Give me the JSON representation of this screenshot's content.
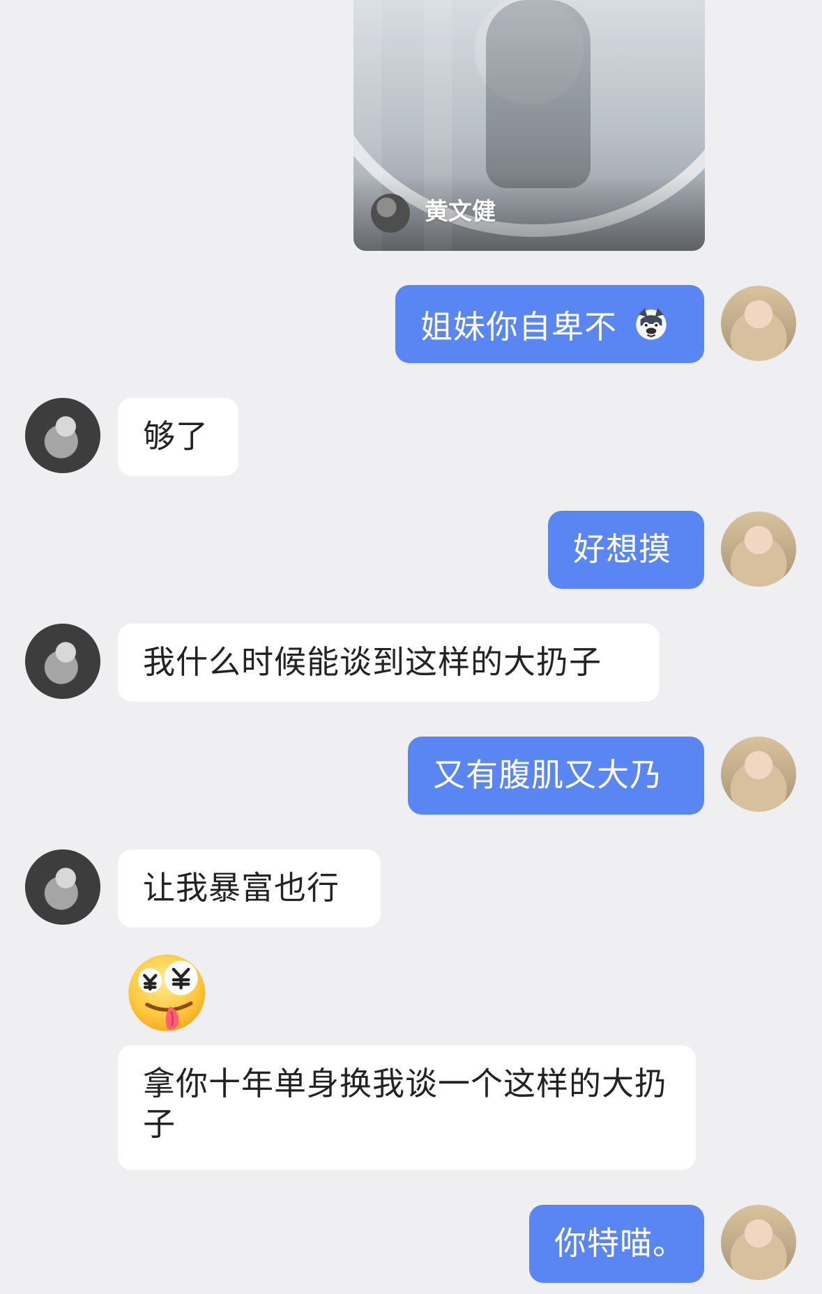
{
  "shared_image": {
    "author_name": "黄文健",
    "photo_label": "",
    "author_avatar_icon": "avatar-icon"
  },
  "messages": [
    {
      "side": "right",
      "text": "姐妹你自卑不",
      "icon": "dog-emoji-icon"
    },
    {
      "side": "left",
      "text": "够了"
    },
    {
      "side": "right",
      "text": "好想摸"
    },
    {
      "side": "left",
      "text": "我什么时候能谈到这样的大扔子"
    },
    {
      "side": "right",
      "text": "又有腹肌又大乃"
    },
    {
      "side": "left",
      "text": "让我暴富也行"
    },
    {
      "side": "left",
      "icon": "money-eyes-emoji-icon"
    },
    {
      "side": "left",
      "text": "拿你十年单身换我谈一个这样的大扔子"
    },
    {
      "side": "right",
      "text": "你特喵。"
    }
  ],
  "colors": {
    "background": "#efeff1",
    "self_bubble": "#5a86f3",
    "other_bubble": "#ffffff",
    "self_text": "#ffffff",
    "other_text": "#222222"
  }
}
